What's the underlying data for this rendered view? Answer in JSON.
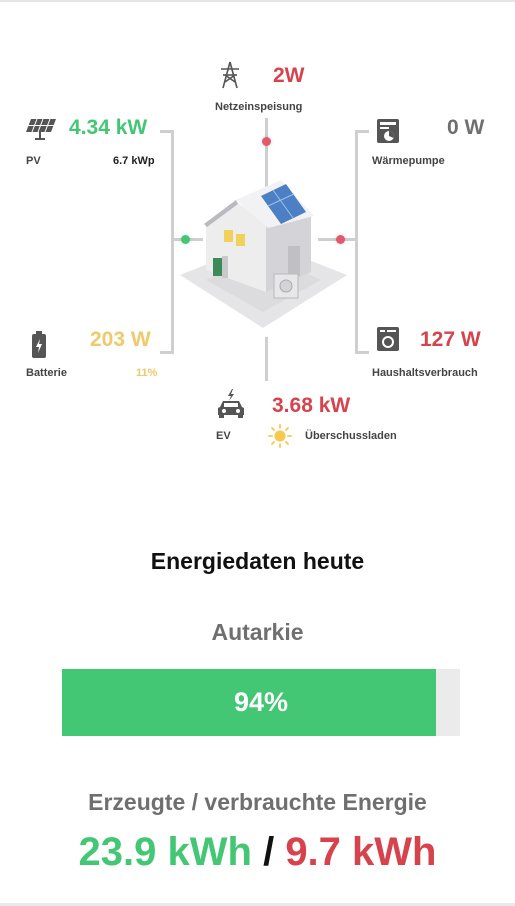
{
  "flow": {
    "grid": {
      "value": "2W",
      "label": "Netzeinspeisung"
    },
    "pv": {
      "value": "4.34 kW",
      "label": "PV",
      "peak": "6.7 kWp"
    },
    "heatpump": {
      "value": "0 W",
      "label": "Wärmepumpe"
    },
    "battery": {
      "value": "203 W",
      "label": "Batterie",
      "soc": "11%"
    },
    "household": {
      "value": "127 W",
      "label": "Haushaltsverbrauch"
    },
    "ev": {
      "value": "3.68 kW",
      "label": "EV",
      "mode": "Überschussladen"
    }
  },
  "today": {
    "title": "Energiedaten heute",
    "autarky_label": "Autarkie",
    "autarky_value": "94%",
    "autarky_fraction": 0.94,
    "energy_title": "Erzeugte / verbrauchte Energie",
    "produced": "23.9 kWh",
    "separator": "/",
    "consumed": "9.7 kWh"
  },
  "colors": {
    "green": "#43c774",
    "red": "#d7434d",
    "yellow": "#f1c86a",
    "line": "#cfcfcf"
  },
  "icons": {
    "grid": "power-tower-icon",
    "pv": "solar-panel-icon",
    "heatpump": "heat-pump-icon",
    "battery": "battery-icon",
    "household": "washing-machine-icon",
    "ev": "car-icon",
    "mode": "sun-icon",
    "house": "house-illustration"
  }
}
